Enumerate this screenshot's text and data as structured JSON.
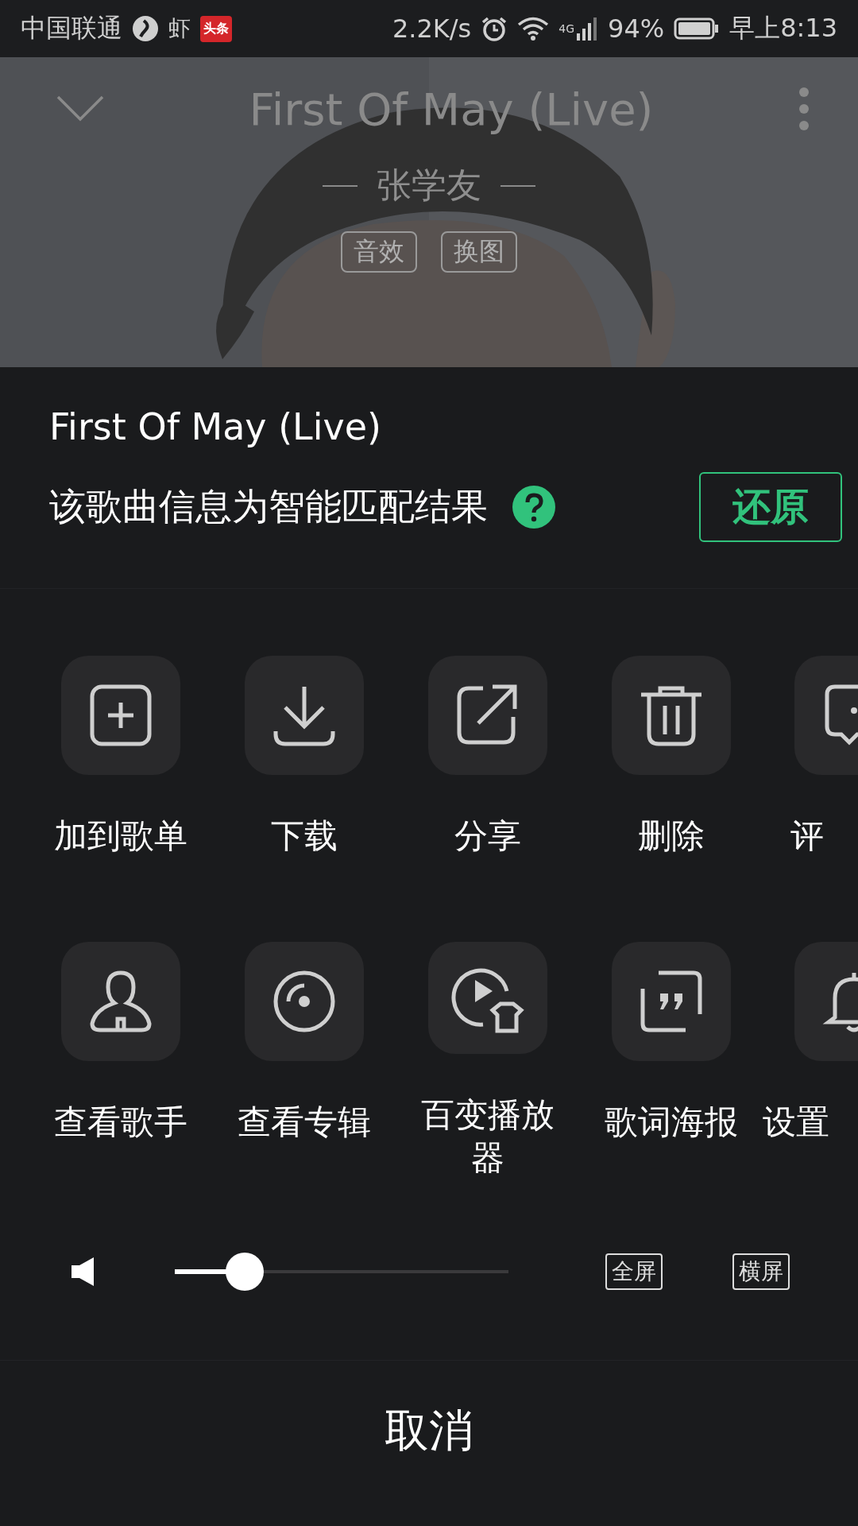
{
  "status_bar": {
    "carrier": "中国联通",
    "app_badge": "虾",
    "news_badge": "头条",
    "speed": "2.2K/s",
    "network": "4G",
    "battery": "94%",
    "time": "早上8:13"
  },
  "header": {
    "title": "First Of May (Live)",
    "artist": "张学友",
    "tags": [
      "音效",
      "换图"
    ]
  },
  "sheet": {
    "title": "First Of May (Live)",
    "match_info": "该歌曲信息为智能匹配结果",
    "restore_button": "还原"
  },
  "actions": [
    [
      {
        "label": "加到歌单"
      },
      {
        "label": "下载"
      },
      {
        "label": "分享"
      },
      {
        "label": "删除"
      },
      {
        "label": "评"
      }
    ],
    [
      {
        "label": "查看歌手"
      },
      {
        "label": "查看专辑"
      },
      {
        "label": "百变播放器"
      },
      {
        "label": "歌词海报"
      },
      {
        "label": "设置"
      }
    ]
  ],
  "volume": {
    "level": 0.21
  },
  "screen_buttons": [
    "全屏",
    "横屏"
  ],
  "cancel_button": "取消"
}
